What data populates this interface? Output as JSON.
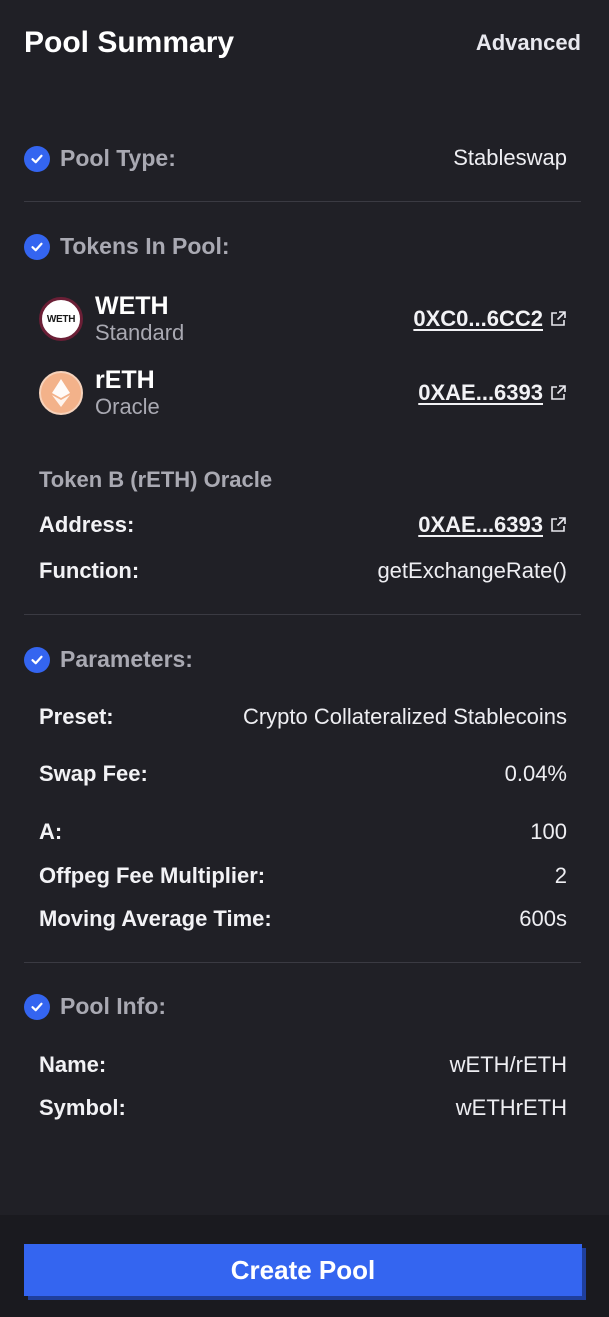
{
  "header": {
    "title": "Pool Summary",
    "advanced_label": "Advanced"
  },
  "pool_type": {
    "label": "Pool Type:",
    "value": "Stableswap"
  },
  "tokens": {
    "label": "Tokens In Pool:",
    "items": [
      {
        "name": "WETH",
        "type": "Standard",
        "address": "0XC0...6CC2",
        "icon_text": "WETH"
      },
      {
        "name": "rETH",
        "type": "Oracle",
        "address": "0XAE...6393"
      }
    ],
    "oracle": {
      "title": "Token B (rETH) Oracle",
      "address_label": "Address:",
      "address_value": "0XAE...6393",
      "function_label": "Function:",
      "function_value": "getExchangeRate()"
    }
  },
  "parameters": {
    "label": "Parameters:",
    "preset_label": "Preset:",
    "preset_value": "Crypto Collateralized Stablecoins",
    "swap_fee_label": "Swap Fee:",
    "swap_fee_value": "0.04%",
    "a_label": "A:",
    "a_value": "100",
    "offpeg_label": "Offpeg Fee Multiplier:",
    "offpeg_value": "2",
    "ma_label": "Moving Average Time:",
    "ma_value": "600s"
  },
  "pool_info": {
    "label": "Pool Info:",
    "name_label": "Name:",
    "name_value": "wETH/rETH",
    "symbol_label": "Symbol:",
    "symbol_value": "wETHrETH"
  },
  "footer": {
    "create_label": "Create Pool"
  },
  "colors": {
    "background": "#202026",
    "accent": "#3465f0",
    "muted": "#a9a9b2"
  }
}
